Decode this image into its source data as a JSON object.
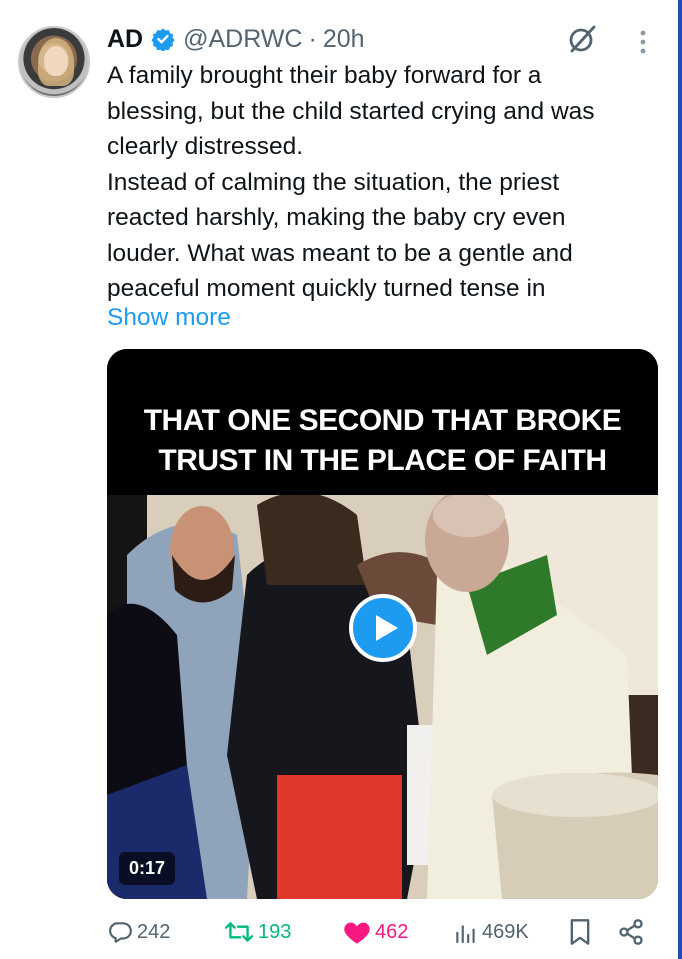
{
  "post": {
    "display_name": "AD",
    "handle": "@ADRWC",
    "separator": "·",
    "time": "20h",
    "text_lines": [
      "A family brought their baby forward for a",
      "blessing, but the child started crying and was",
      "clearly distressed.",
      "Instead of calming the situation, the priest",
      "reacted harshly, making the baby cry even",
      "louder. What was meant to be a gentle and",
      "peaceful moment quickly turned tense in"
    ],
    "show_more": "Show more"
  },
  "media": {
    "caption_lines": [
      "THAT ONE SECOND THAT BROKE",
      "TRUST IN THE PLACE OF FAITH"
    ],
    "duration": "0:17"
  },
  "actions": {
    "replies": "242",
    "reposts": "193",
    "likes": "462",
    "views": "469K"
  },
  "colors": {
    "accent": "#1d9bf0",
    "repost": "#00ba7c",
    "like": "#f91880",
    "muted": "#536471"
  }
}
